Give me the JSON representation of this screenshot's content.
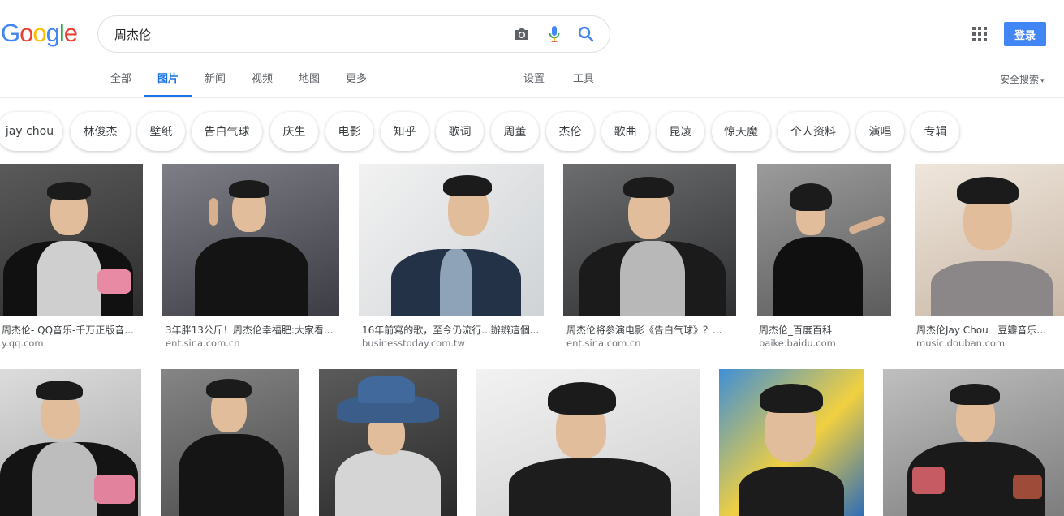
{
  "logo": {
    "g1": "G",
    "o1": "o",
    "o2": "o",
    "g2": "g",
    "l": "l",
    "e": "e"
  },
  "search": {
    "value": "周杰伦"
  },
  "icons": {
    "camera": "camera-icon",
    "mic": "mic-icon",
    "search": "search-icon",
    "apps": "apps-grid-icon"
  },
  "header": {
    "login_label": "登录"
  },
  "tabs": [
    {
      "label": "全部"
    },
    {
      "label": "图片"
    },
    {
      "label": "新闻"
    },
    {
      "label": "视频"
    },
    {
      "label": "地图"
    },
    {
      "label": "更多"
    },
    {
      "label": "设置"
    },
    {
      "label": "工具"
    }
  ],
  "safe_search": {
    "label": "安全搜索"
  },
  "chips": [
    {
      "label": "jay chou"
    },
    {
      "label": "林俊杰"
    },
    {
      "label": "壁纸"
    },
    {
      "label": "告白气球"
    },
    {
      "label": "庆生"
    },
    {
      "label": "电影"
    },
    {
      "label": "知乎"
    },
    {
      "label": "歌词"
    },
    {
      "label": "周董"
    },
    {
      "label": "杰伦"
    },
    {
      "label": "歌曲"
    },
    {
      "label": "昆凌"
    },
    {
      "label": "惊天魔"
    },
    {
      "label": "个人资料"
    },
    {
      "label": "演唱"
    },
    {
      "label": "专辑"
    }
  ],
  "results": [
    {
      "caption": "周杰伦- QQ音乐-千万正版音...",
      "source": "y.qq.com"
    },
    {
      "caption": "3年胖13公斤！周杰伦幸福肥:大家看...",
      "source": "ent.sina.com.cn"
    },
    {
      "caption": "16年前寫的歌，至今仍流行...辦辦這個...",
      "source": "businesstoday.com.tw"
    },
    {
      "caption": "周杰伦将参演电影《告白气球》？...",
      "source": "ent.sina.com.cn"
    },
    {
      "caption": "周杰伦_百度百科",
      "source": "baike.baidu.com"
    },
    {
      "caption": "周杰伦Jay Chou | 豆瓣音乐...",
      "source": "music.douban.com"
    }
  ],
  "colors": {
    "accent": "#1a73e8",
    "login_bg": "#4285f4",
    "chip_text": "#3c4043",
    "source_text": "#70757a"
  }
}
